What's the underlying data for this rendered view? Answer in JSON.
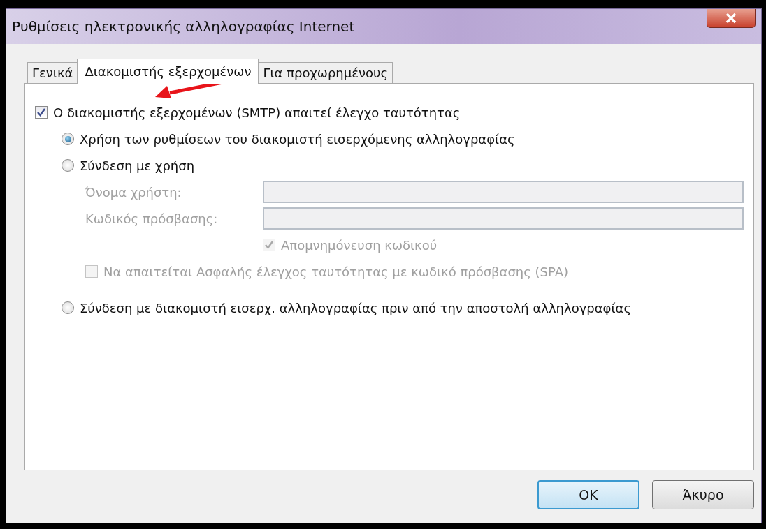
{
  "window": {
    "title": "Ρυθμίσεις ηλεκτρονικής αλληλογραφίας Internet"
  },
  "tabs": [
    {
      "label": "Γενικά",
      "selected": false
    },
    {
      "label": "Διακομιστής εξερχομένων",
      "selected": true
    },
    {
      "label": "Για προχωρημένους",
      "selected": false
    }
  ],
  "auth_required": {
    "label": "Ο διακομιστής εξερχομένων (SMTP) απαιτεί έλεγχο ταυτότητας",
    "checked": true
  },
  "options": [
    {
      "label": "Χρήση των ρυθμίσεων του διακομιστή εισερχόμενης αλληλογραφίας",
      "selected": true
    },
    {
      "label": "Σύνδεση με χρήση",
      "selected": false,
      "login": {
        "fields": [
          {
            "label": "Όνομα χρήστη:",
            "disabled": true
          },
          {
            "label": "Κωδικός πρόσβασης:",
            "disabled": true
          }
        ],
        "remember": {
          "label": "Απομνημόνευση κωδικού",
          "checked": true,
          "disabled": true
        },
        "spa": {
          "label": "Να απαιτείται Ασφαλής έλεγχος ταυτότητας με κωδικό πρόσβασης (SPA)",
          "checked": false,
          "disabled": true
        }
      }
    },
    {
      "label": "Σύνδεση με διακομιστή εισερχ. αλληλογραφίας πριν από την αποστολή αλληλογραφίας",
      "selected": false
    }
  ],
  "buttons": [
    {
      "label": "OK",
      "kind": "default"
    },
    {
      "label": "Άκυρο",
      "kind": "normal"
    }
  ]
}
